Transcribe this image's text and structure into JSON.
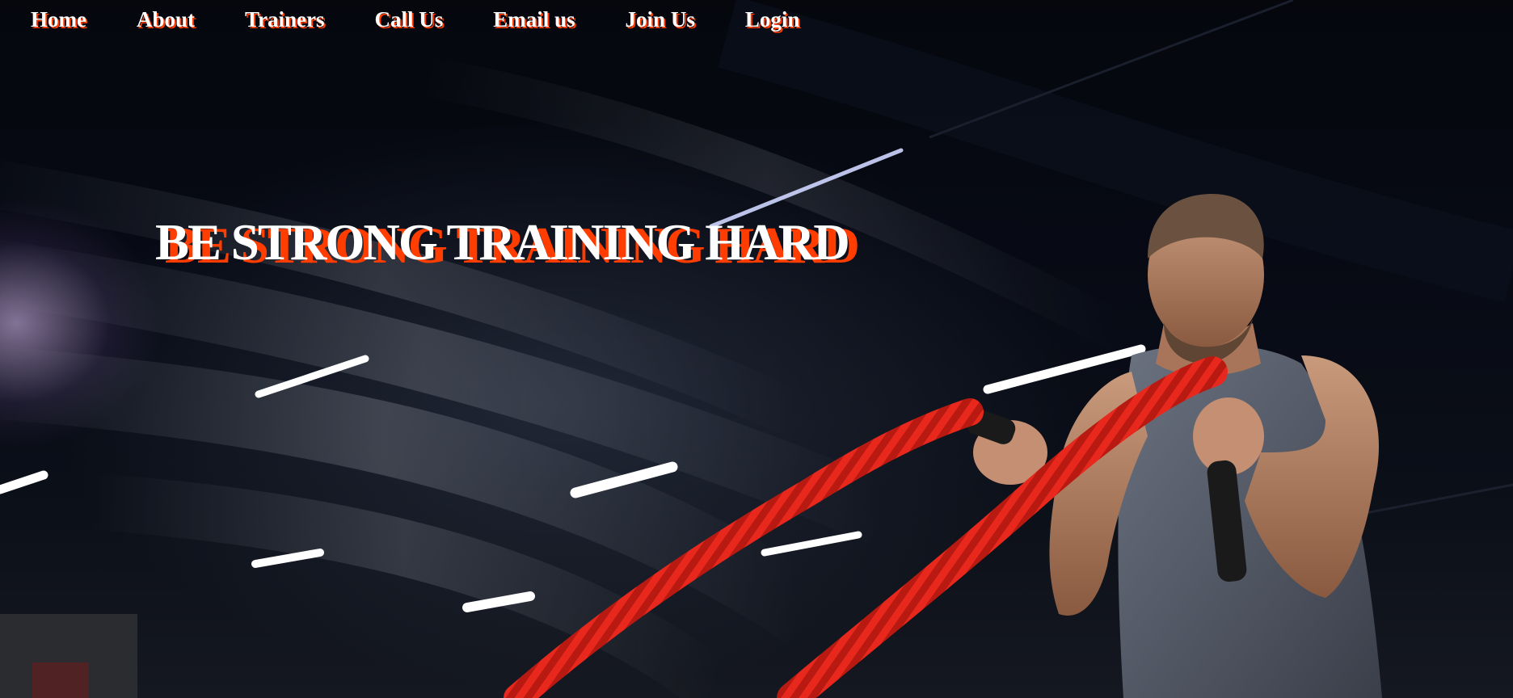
{
  "nav": {
    "items": [
      {
        "label": "Home"
      },
      {
        "label": "About"
      },
      {
        "label": "Trainers"
      },
      {
        "label": "Call Us"
      },
      {
        "label": "Email us"
      },
      {
        "label": "Join Us"
      },
      {
        "label": "Login"
      }
    ]
  },
  "hero": {
    "headline": "BE STRONG TRAINING HARD"
  },
  "colors": {
    "accent": "#ff3d00",
    "text": "#ffffff",
    "background": "#04070f",
    "rope": "#e8281c"
  }
}
